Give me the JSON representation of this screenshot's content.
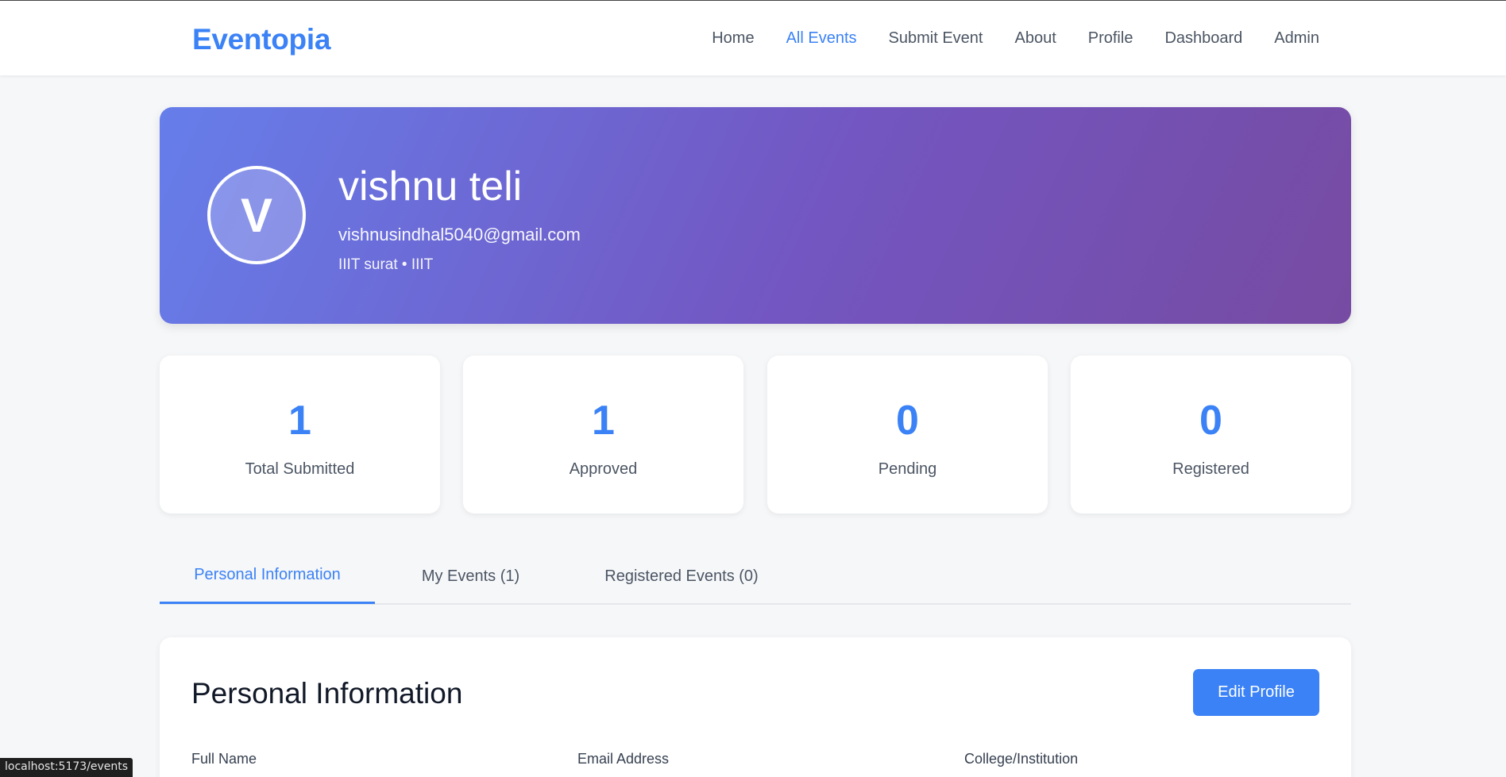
{
  "nav": {
    "brand": "Eventopia",
    "links": [
      {
        "label": "Home",
        "active": false
      },
      {
        "label": "All Events",
        "active": true
      },
      {
        "label": "Submit Event",
        "active": false
      },
      {
        "label": "About",
        "active": false
      },
      {
        "label": "Profile",
        "active": false
      },
      {
        "label": "Dashboard",
        "active": false
      },
      {
        "label": "Admin",
        "active": false
      }
    ]
  },
  "profile": {
    "avatar_initial": "V",
    "name": "vishnu teli",
    "email": "vishnusindhal5040@gmail.com",
    "institution_line": "IIIT surat • IIIT"
  },
  "stats": [
    {
      "value": "1",
      "label": "Total Submitted"
    },
    {
      "value": "1",
      "label": "Approved"
    },
    {
      "value": "0",
      "label": "Pending"
    },
    {
      "value": "0",
      "label": "Registered"
    }
  ],
  "tabs": [
    {
      "label": "Personal Information",
      "active": true
    },
    {
      "label": "My Events (1)",
      "active": false
    },
    {
      "label": "Registered Events (0)",
      "active": false
    }
  ],
  "personal_info": {
    "title": "Personal Information",
    "edit_button": "Edit Profile",
    "fields": [
      {
        "label": "Full Name"
      },
      {
        "label": "Email Address"
      },
      {
        "label": "College/Institution"
      }
    ]
  },
  "status_bar": {
    "url": "localhost:5173/events"
  },
  "colors": {
    "accent": "#3b82f6",
    "hero_gradient_start": "#667eea",
    "hero_gradient_end": "#764ba2",
    "page_background": "#f6f7f9"
  }
}
